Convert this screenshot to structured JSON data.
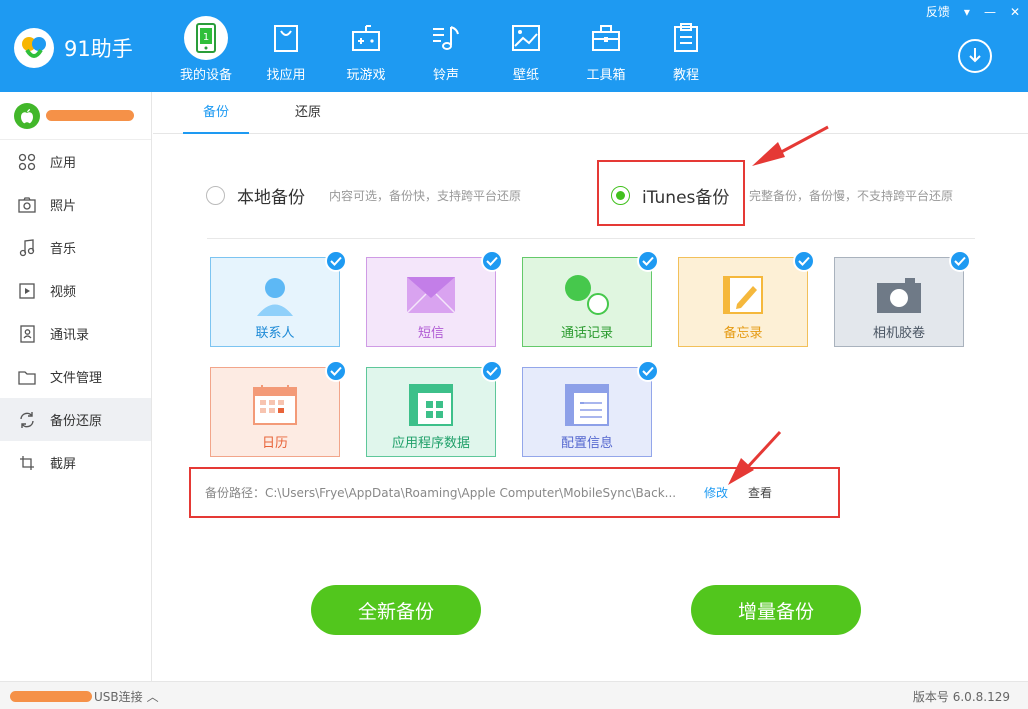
{
  "app": {
    "name": "91助手"
  },
  "window_controls": {
    "feedback": "反馈",
    "menu": "▾",
    "minimize": "—",
    "close": "✕"
  },
  "nav": [
    {
      "label": "我的设备",
      "icon": "phone-icon",
      "active": true
    },
    {
      "label": "找应用",
      "icon": "bag-icon"
    },
    {
      "label": "玩游戏",
      "icon": "gamepad-icon"
    },
    {
      "label": "铃声",
      "icon": "music-icon"
    },
    {
      "label": "壁纸",
      "icon": "image-icon"
    },
    {
      "label": "工具箱",
      "icon": "toolbox-icon"
    },
    {
      "label": "教程",
      "icon": "clipboard-icon"
    }
  ],
  "sidebar": {
    "items": [
      {
        "label": "应用",
        "icon": "apps-icon"
      },
      {
        "label": "照片",
        "icon": "camera-icon"
      },
      {
        "label": "音乐",
        "icon": "music-note-icon"
      },
      {
        "label": "视频",
        "icon": "video-icon"
      },
      {
        "label": "通讯录",
        "icon": "contacts-icon"
      },
      {
        "label": "文件管理",
        "icon": "folder-icon"
      },
      {
        "label": "备份还原",
        "icon": "sync-icon",
        "active": true
      },
      {
        "label": "截屏",
        "icon": "crop-icon"
      }
    ]
  },
  "tabs": [
    {
      "label": "备份",
      "active": true
    },
    {
      "label": "还原"
    }
  ],
  "backup_options": {
    "local": {
      "title": "本地备份",
      "desc": "内容可选，备份快，支持跨平台还原",
      "selected": false
    },
    "itunes": {
      "title": "iTunes备份",
      "desc": "完整备份，备份慢，不支持跨平台还原",
      "selected": true
    }
  },
  "tiles": [
    {
      "label": "联系人",
      "icon": "contact-person-icon",
      "checked": true
    },
    {
      "label": "短信",
      "icon": "envelope-icon",
      "checked": true
    },
    {
      "label": "通话记录",
      "icon": "call-log-icon",
      "checked": true
    },
    {
      "label": "备忘录",
      "icon": "memo-icon",
      "checked": true
    },
    {
      "label": "相机胶卷",
      "icon": "camera-roll-icon",
      "checked": true
    },
    {
      "label": "日历",
      "icon": "calendar-icon",
      "checked": true
    },
    {
      "label": "应用程序数据",
      "icon": "app-data-icon",
      "checked": true
    },
    {
      "label": "配置信息",
      "icon": "config-icon",
      "checked": true
    }
  ],
  "backup_path": {
    "text": "备份路径：C:\\Users\\Frye\\AppData\\Roaming\\Apple Computer\\MobileSync\\Back...",
    "modify": "修改",
    "view": "查看"
  },
  "buttons": {
    "new_backup": "全新备份",
    "incremental_backup": "增量备份"
  },
  "status": {
    "connection": "USB连接",
    "caret": "︿",
    "version": "版本号 6.0.8.129"
  },
  "colors": {
    "primary": "#1e9af2",
    "accent_green": "#52c61d",
    "highlight_red": "#e53935"
  }
}
